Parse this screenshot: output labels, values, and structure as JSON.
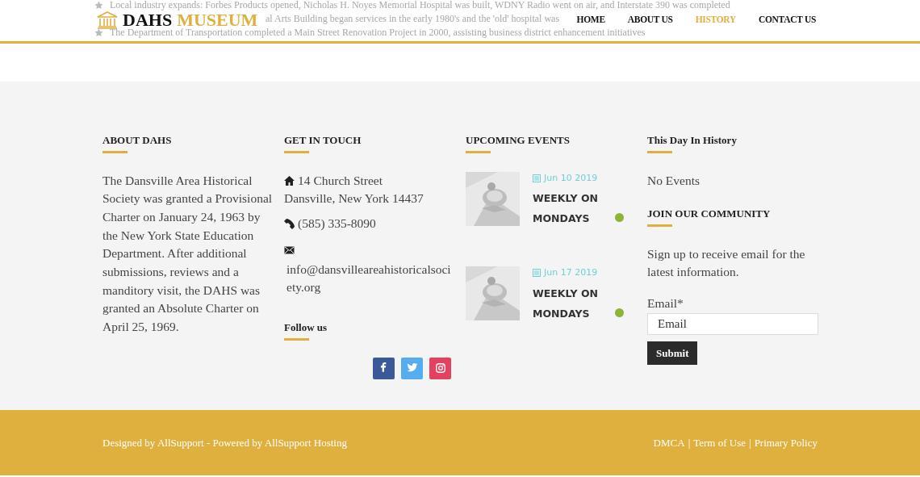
{
  "behind_header": [
    {
      "text": "Local industry expands: Forbes Products opened, Nicholas H. Noyes Memorial Hospital was built, WDNY Radio went on air, and Interstate 390 was completed",
      "bullet": true
    },
    {
      "text": "al Arts Building began services in the early 1980's and the 'old' hospital was",
      "bullet": false
    },
    {
      "text": "The Department of Transportation completed a Main Street Renovation Project in 2000, assisting business district enhancement initiatives",
      "bullet": true
    }
  ],
  "header": {
    "logo_first": "DAHS",
    "logo_second": "MUSEUM",
    "nav": [
      {
        "label": "HOME",
        "selected": false
      },
      {
        "label": "ABOUT US",
        "selected": false
      },
      {
        "label": "HISTORY",
        "selected": true
      },
      {
        "label": "CONTACT US",
        "selected": false
      }
    ]
  },
  "about": {
    "heading": "ABOUT DAHS",
    "text": "The Dansville Area Historical Society was granted a Provisional Charter on January 24, 1963 by the New York State Education Department. After additional submissions, reviews and a manditory visit, the DAHS was granted an Absolute Charter on April 25, 1969."
  },
  "contact": {
    "heading": "GET IN TOUCH",
    "address_line1": "14 Church Street",
    "address_line2": "Dansville, New York 14437",
    "phone": "(585) 335-8090",
    "email": "info@dansvilleareahistoricalsociety.org",
    "follow_heading": "Follow us",
    "social": [
      {
        "kind": "facebook",
        "color": "#3b5998"
      },
      {
        "kind": "twitter",
        "color": "#55acee"
      },
      {
        "kind": "instagram",
        "color": "#e4405f"
      }
    ]
  },
  "events": {
    "heading": "UPCOMING EVENTS",
    "items": [
      {
        "date": "Jun 10 2019",
        "title": "WEEKLY ON MONDAYS",
        "color": "#8cb33a"
      },
      {
        "date": "Jun 17 2019",
        "title": "WEEKLY ON MONDAYS",
        "color": "#8cb33a"
      }
    ]
  },
  "history": {
    "heading": "This Day In History",
    "text": "No Events"
  },
  "community": {
    "heading": "JOIN OUR COMMUNITY",
    "text": "Sign up to receive email for the latest information.",
    "label": "Email*",
    "placeholder": "Email",
    "button": "Submit"
  },
  "footer": {
    "credit": "Designed by AllSupport - Powered by AllSupport Hosting",
    "links": [
      "DMCA",
      "Term of Use",
      "Primary Policy"
    ],
    "separator": "|"
  }
}
